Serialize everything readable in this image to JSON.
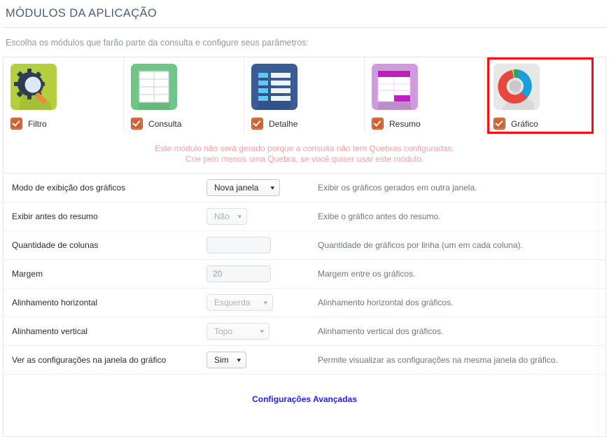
{
  "header": {
    "title": "MÓDULOS DA APLICAÇÃO",
    "subtitle": "Escolha os módulos que farão parte da consulta e configure seus parâmetros:"
  },
  "modules": [
    {
      "label": "Filtro",
      "icon": "magnifier-gear-icon",
      "checked": true,
      "selected": false,
      "tile_color": "#b3ce3e"
    },
    {
      "label": "Consulta",
      "icon": "grid-table-icon",
      "checked": true,
      "selected": false,
      "tile_color": "#71c587"
    },
    {
      "label": "Detalhe",
      "icon": "detail-list-icon",
      "checked": true,
      "selected": false,
      "tile_color": "#3a5c96"
    },
    {
      "label": "Resumo",
      "icon": "summary-table-icon",
      "checked": true,
      "selected": false,
      "tile_color": "#cf9bdd"
    },
    {
      "label": "Gráfico",
      "icon": "pie-chart-icon",
      "checked": true,
      "selected": true,
      "tile_color": "#e7e7e7"
    }
  ],
  "selection_color": "#fb0b0b",
  "warning": {
    "color": "#ffa0a6",
    "line1": "Este módulo não será gerado porque a consulta não tem Quebras configuradas.",
    "line2": "Crie pelo menos uma Quebra, se você quiser usar este módulo."
  },
  "settings": [
    {
      "label": "Modo de exibição dos gráficos",
      "control": "select",
      "value": "Nova janela",
      "enabled": true,
      "description": "Exibir os gráficos gerados em outra janela."
    },
    {
      "label": "Exibir antes do resumo",
      "control": "select",
      "value": "Não",
      "enabled": false,
      "description": "Exibe o gráfico antes do resumo."
    },
    {
      "label": "Quantidade de colunas",
      "control": "text",
      "value": "",
      "placeholder": "",
      "enabled": false,
      "description": "Quantidade de gráficos por linha (um em cada coluna)."
    },
    {
      "label": "Margem",
      "control": "text",
      "value": "20",
      "placeholder": "20",
      "enabled": false,
      "description": "Margem entre os gráficos."
    },
    {
      "label": "Alinhamento horizontal",
      "control": "select",
      "value": "Esquerda",
      "enabled": false,
      "description": "Alinhamento horizontal dos gráficos."
    },
    {
      "label": "Alinhamento vertical",
      "control": "select",
      "value": "Topo",
      "enabled": false,
      "description": "Alinhamento vertical dos gráficos."
    },
    {
      "label": "Ver as configurações na janela do gráfico",
      "control": "select",
      "value": "Sim",
      "enabled": true,
      "description": "Permite visualizar as configurações na mesma janela do gráfico."
    }
  ],
  "advanced_link": {
    "label": "Configurações Avançadas",
    "color": "#2222ee"
  }
}
